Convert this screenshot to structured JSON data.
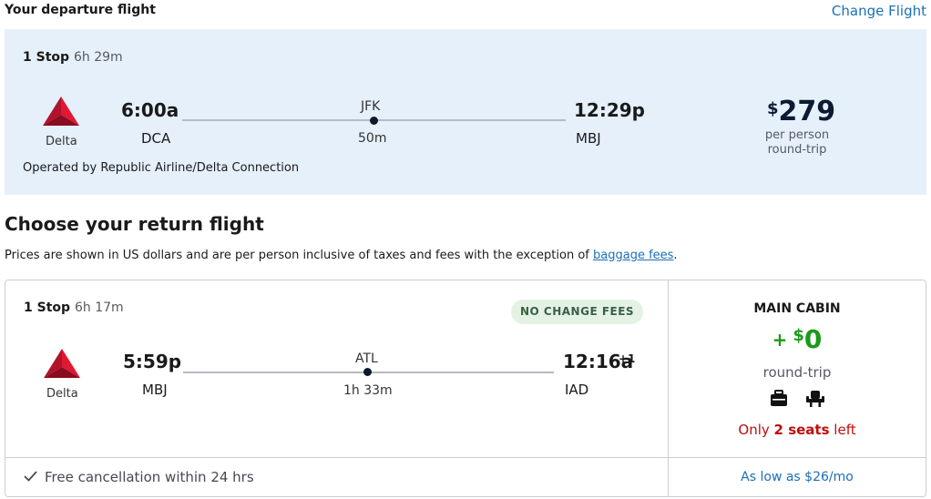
{
  "departure": {
    "header": "Your departure flight",
    "change_link": "Change Flight",
    "stops": "1 Stop",
    "duration": "6h 29m",
    "airline": "Delta",
    "depart_time": "6:00a",
    "depart_code": "DCA",
    "via_code": "JFK",
    "via_duration": "50m",
    "arrive_time": "12:29p",
    "arrive_code": "MBJ",
    "price_currency": "$",
    "price_amount": "279",
    "price_per": "per person",
    "price_trip": "round-trip",
    "operated_by": "Operated by Republic Airline/Delta Connection"
  },
  "return_section": {
    "title": "Choose your return flight",
    "disclaimer_prefix": "Prices are shown in US dollars and are per person inclusive of taxes and fees with the exception of ",
    "disclaimer_link": "baggage fees",
    "disclaimer_suffix": "."
  },
  "return_flight": {
    "stops": "1 Stop",
    "duration": "6h 17m",
    "badge": "NO CHANGE FEES",
    "airline": "Delta",
    "depart_time": "5:59p",
    "depart_code": "MBJ",
    "via_code": "ATL",
    "via_duration": "1h 33m",
    "arrive_time": "12:16a",
    "arrive_day_offset": "+1",
    "arrive_code": "IAD",
    "cabin": "MAIN CABIN",
    "fare_plus": "+",
    "fare_currency": "$",
    "fare_amount": "0",
    "fare_trip": "round-trip",
    "seats_prefix": "Only ",
    "seats_bold": "2 seats",
    "seats_suffix": " left",
    "cancellation": "Free cancellation within 24 hrs",
    "as_low_as": "As low as $26/mo",
    "amenity_icons": [
      "carry-on-bag-icon",
      "seat-icon"
    ]
  },
  "colors": {
    "delta_red": "#c8102e",
    "link_blue": "#1b6fb8",
    "fare_green": "#1a9a1a",
    "seats_red": "#c00d0d",
    "departure_bg": "#e6f0fb",
    "badge_bg": "#e3f2e3"
  }
}
